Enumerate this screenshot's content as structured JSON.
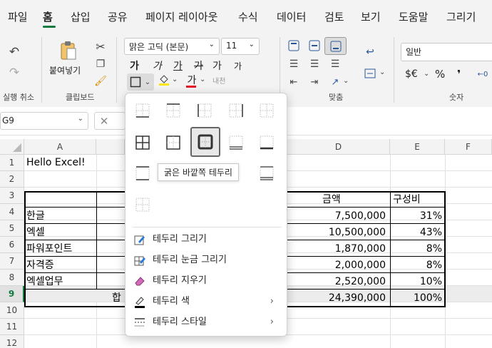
{
  "menu": {
    "tabs": [
      "파일",
      "홈",
      "삽입",
      "공유",
      "페이지 레이아웃",
      "수식",
      "데이터",
      "검토",
      "보기",
      "도움말",
      "그리기"
    ],
    "active_index": 1
  },
  "ribbon": {
    "undo_group_label": "실행 취소",
    "clipboard": {
      "paste_label": "붙여넣기",
      "group_label": "클립보드"
    },
    "font": {
      "name": "맑은 고딕 (본문)",
      "size": "11",
      "bold": "가",
      "italic": "가",
      "underline": "가",
      "strike": "가",
      "grow": "가",
      "shrink": "가",
      "phonetic": "내천"
    },
    "align_group_label": "맞춤",
    "number": {
      "format": "일반",
      "currency": "$€",
      "percent": "%",
      "comma": "❜",
      "group_label": "숫자"
    }
  },
  "formula_bar": {
    "name_box": "G9"
  },
  "grid": {
    "columns": [
      "A",
      "D",
      "E",
      "F"
    ],
    "rows": [
      "1",
      "2",
      "3",
      "4",
      "5",
      "6",
      "7",
      "8",
      "9",
      "10",
      "11",
      "12"
    ],
    "a1": "Hello Excel!",
    "header_amount": "금액",
    "header_ratio": "구성비",
    "items": [
      {
        "name": "한글",
        "amount": "7,500,000",
        "ratio": "31%"
      },
      {
        "name": "엑셀",
        "amount": "10,500,000",
        "ratio": "43%"
      },
      {
        "name": "파워포인트",
        "amount": "1,870,000",
        "ratio": "8%"
      },
      {
        "name": "자격증",
        "amount": "2,000,000",
        "ratio": "8%"
      },
      {
        "name": "엑셀업무",
        "amount": "2,520,000",
        "ratio": "10%"
      }
    ],
    "total_label": "합",
    "total_amount": "24,390,000",
    "total_ratio": "100%"
  },
  "border_menu": {
    "tooltip": "굵은 바깥쪽 테두리",
    "items": [
      {
        "label": "테두리 그리기",
        "icon": "pencil-border-icon"
      },
      {
        "label": "테두리 눈금 그리기",
        "icon": "pencil-grid-icon"
      },
      {
        "label": "테두리 지우기",
        "icon": "eraser-icon"
      },
      {
        "label": "테두리 색",
        "icon": "pencil-color-icon",
        "submenu": true
      },
      {
        "label": "테두리 스타일",
        "icon": "line-style-icon",
        "submenu": true
      }
    ]
  },
  "colors": {
    "accent": "#0f7b3f",
    "font_red": "#e81123",
    "highlight_yellow": "#ffe600",
    "grid_line": "#e1e1e1",
    "selected_row": "#0f7b3f"
  }
}
